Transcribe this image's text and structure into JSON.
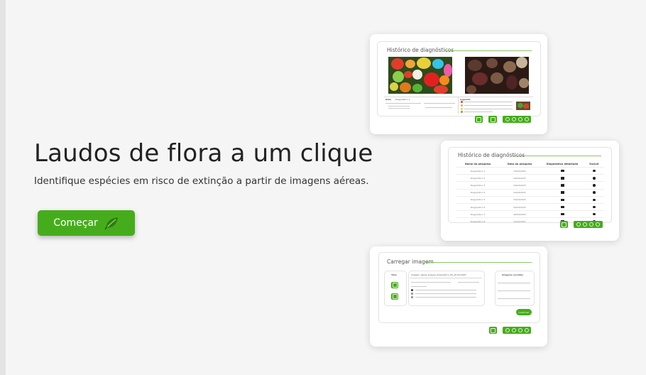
{
  "hero": {
    "title": "Laudos de flora a um clique",
    "subtitle": "Identifique espécies em risco de extinção a partir de imagens aéreas.",
    "cta_label": "Começar",
    "cta_icon": "leaf-icon"
  },
  "colors": {
    "accent": "#45ad1b",
    "background": "#f5f5f5",
    "card": "#ffffff"
  },
  "card_diagnostics": {
    "title": "Histórico de diagnósticos",
    "data_label": "Data",
    "data_value": "Diagnóstico 1",
    "legend_label": "Legenda"
  },
  "card_history": {
    "title": "Histórico de diagnósticos",
    "columns": [
      "Nome da pesquisa",
      "Data da pesquisa",
      "Diagnóstico detalhado",
      "Excluir"
    ],
    "rows": [
      {
        "name": "Diagnóstico 1",
        "date": "13/03/2023"
      },
      {
        "name": "Diagnóstico 2",
        "date": "04/04/2023"
      },
      {
        "name": "Diagnóstico 3",
        "date": "04/04/2023"
      },
      {
        "name": "Diagnóstico 4",
        "date": "04/04/2023"
      },
      {
        "name": "Diagnóstico 5",
        "date": "04/04/2023"
      },
      {
        "name": "Diagnóstico 6",
        "date": "04/04/2023"
      },
      {
        "name": "Diagnóstico 7",
        "date": "20/04/2023"
      },
      {
        "name": "Diagnóstico 8",
        "date": "31/04/2023"
      }
    ]
  },
  "card_upload": {
    "title": "Carregar imagem",
    "tools_label": "Tiles",
    "file_name": "Imagem_aérea_bosque_diagnóstico_05_10.04.2023",
    "recent_label": "Imagens recentes",
    "confirm_label": "Confirmar"
  }
}
